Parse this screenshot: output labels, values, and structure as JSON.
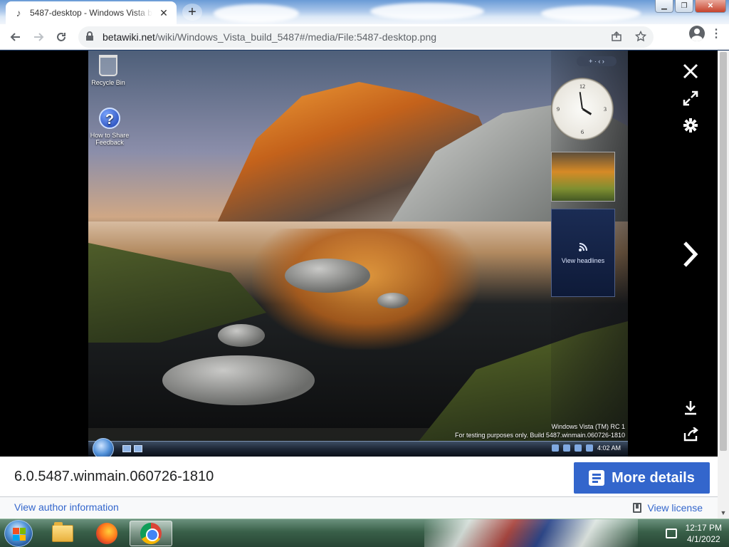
{
  "browser": {
    "tab": {
      "favicon": "music-note-icon",
      "title": "5487-desktop - Windows Vista build 5487"
    },
    "omnibox": {
      "domain": "betawiki.net",
      "path": "/wiki/Windows_Vista_build_5487#/media/File:5487-desktop.png"
    }
  },
  "screenshot": {
    "desktop_icons": [
      {
        "label": "Recycle Bin"
      },
      {
        "label": "How to Share Feedback"
      }
    ],
    "sidebar": {
      "feed_label": "View headlines"
    },
    "watermark": {
      "line1": "Windows Vista (TM) RC 1",
      "line2": "For testing purposes only. Build 5487.winmain.060726-1810"
    },
    "vista_clock": "4:02 AM"
  },
  "viewer": {
    "file_description": "6.0.5487.winmain.060726-1810",
    "more_details_label": "More details",
    "author_link": "View author information",
    "license_link": "View license"
  },
  "taskbar": {
    "time": "12:17 PM",
    "date": "4/1/2022"
  },
  "colors": {
    "accent": "#3366cc",
    "viewer_bg": "#000000",
    "link": "#3366cc"
  }
}
